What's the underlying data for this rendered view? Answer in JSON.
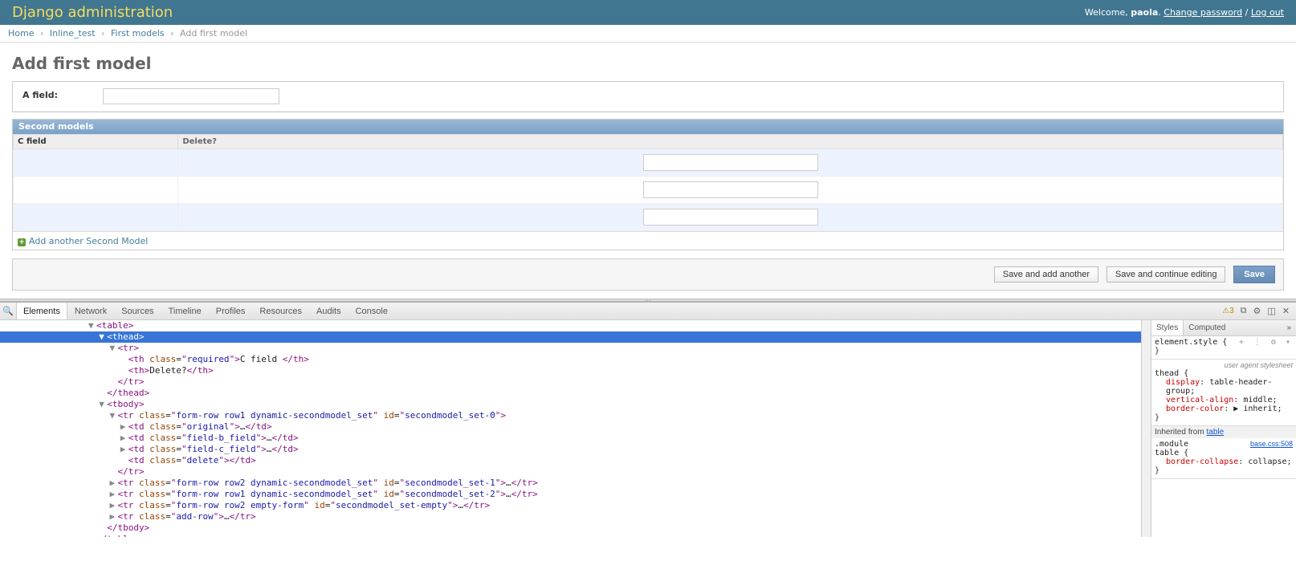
{
  "header": {
    "branding": "Django administration",
    "welcome": "Welcome,",
    "user": "paola",
    "change_password": "Change password",
    "logout": "Log out"
  },
  "breadcrumbs": {
    "home": "Home",
    "app": "Inline_test",
    "model": "First models",
    "action": "Add first model",
    "sep": "›"
  },
  "page_title": "Add first model",
  "form": {
    "a_field_label": "A field:"
  },
  "inline": {
    "title": "Second models",
    "th_cfield": "C field",
    "th_delete": "Delete?",
    "add_another": "Add another Second Model"
  },
  "submit": {
    "save_add_another": "Save and add another",
    "save_continue": "Save and continue editing",
    "save": "Save"
  },
  "devtools": {
    "tabs": [
      "Elements",
      "Network",
      "Sources",
      "Timeline",
      "Profiles",
      "Resources",
      "Audits",
      "Console"
    ],
    "active_tab": 0,
    "warn_count": "3",
    "styles_tabs": [
      "Styles",
      "Computed"
    ],
    "styles_active": 0,
    "elements_lines": [
      {
        "indent": 8,
        "arrow": "▼",
        "html": "<table>",
        "sel": false
      },
      {
        "indent": 9,
        "arrow": "▼",
        "html": "<thead>",
        "sel": true
      },
      {
        "indent": 10,
        "arrow": "▼",
        "html": "<tr>",
        "sel": false
      },
      {
        "indent": 11,
        "arrow": "",
        "html": "<th class=\"required\">C field </th>",
        "sel": false
      },
      {
        "indent": 11,
        "arrow": "",
        "html": "<th>Delete?</th>",
        "sel": false
      },
      {
        "indent": 10,
        "arrow": "",
        "html": "</tr>",
        "sel": false
      },
      {
        "indent": 9,
        "arrow": "",
        "html": "</thead>",
        "sel": false
      },
      {
        "indent": 9,
        "arrow": "▼",
        "html": "<tbody>",
        "sel": false
      },
      {
        "indent": 10,
        "arrow": "▼",
        "html": "<tr class=\"form-row row1 dynamic-secondmodel_set\" id=\"secondmodel_set-0\">",
        "sel": false
      },
      {
        "indent": 11,
        "arrow": "▶",
        "html": "<td class=\"original\">…</td>",
        "sel": false
      },
      {
        "indent": 11,
        "arrow": "▶",
        "html": "<td class=\"field-b_field\">…</td>",
        "sel": false
      },
      {
        "indent": 11,
        "arrow": "▶",
        "html": "<td class=\"field-c_field\">…</td>",
        "sel": false
      },
      {
        "indent": 11,
        "arrow": "",
        "html": "<td class=\"delete\"></td>",
        "sel": false
      },
      {
        "indent": 10,
        "arrow": "",
        "html": "</tr>",
        "sel": false
      },
      {
        "indent": 10,
        "arrow": "▶",
        "html": "<tr class=\"form-row row2 dynamic-secondmodel_set\" id=\"secondmodel_set-1\">…</tr>",
        "sel": false
      },
      {
        "indent": 10,
        "arrow": "▶",
        "html": "<tr class=\"form-row row1 dynamic-secondmodel_set\" id=\"secondmodel_set-2\">…</tr>",
        "sel": false
      },
      {
        "indent": 10,
        "arrow": "▶",
        "html": "<tr class=\"form-row row2 empty-form\" id=\"secondmodel_set-empty\">…</tr>",
        "sel": false
      },
      {
        "indent": 10,
        "arrow": "▶",
        "html": "<tr class=\"add-row\">…</tr>",
        "sel": false
      },
      {
        "indent": 9,
        "arrow": "",
        "html": "</tbody>",
        "sel": false
      },
      {
        "indent": 8,
        "arrow": "",
        "html": "</table>",
        "sel": false
      }
    ],
    "styles_panel": {
      "element_style_label": "element.style {",
      "close_brace": "}",
      "uas_label": "user agent stylesheet",
      "thead_sel": "thead {",
      "thead_rules": [
        {
          "p": "display",
          "v": "table-header-group;"
        },
        {
          "p": "vertical-align",
          "v": "middle;"
        },
        {
          "p": "border-color",
          "v": "▶ inherit;"
        }
      ],
      "inherited_label": "Inherited from",
      "inherited_link": "table",
      "module_sel": ".module",
      "module_src": "base.css:508",
      "table_sel": "table {",
      "table_rules": [
        {
          "p": "border-collapse",
          "v": "collapse;"
        }
      ]
    }
  }
}
